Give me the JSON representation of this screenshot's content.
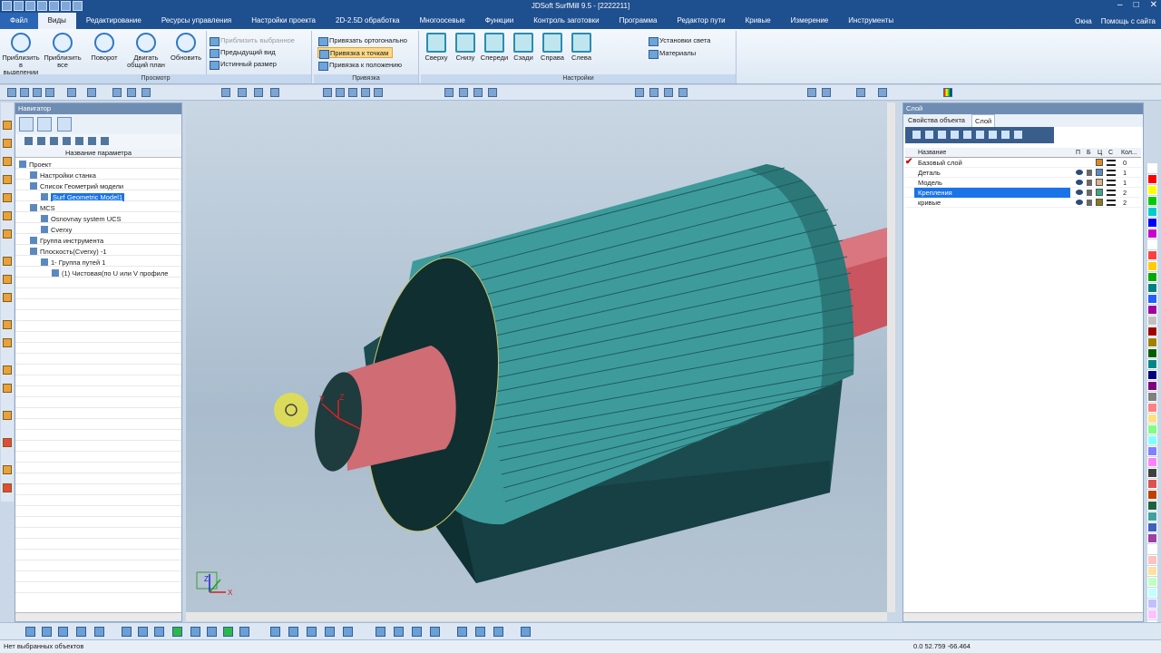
{
  "window": {
    "title": "JDSoft SurfMill 9.5 - [2222211]"
  },
  "menu": {
    "tabs": [
      "Файл",
      "Виды",
      "Редактирование",
      "Ресурсы управления",
      "Настройки проекта",
      "2D-2.5D обработка",
      "Многоосевые",
      "Функции",
      "Контроль заготовки",
      "Программа",
      "Редактор пути",
      "Кривые",
      "Измерение",
      "Инструменты"
    ],
    "active_index": 1,
    "right": {
      "windows": "Окна",
      "help": "Помощь с сайта"
    }
  },
  "ribbon": {
    "view_group": {
      "label": "Просмотр",
      "buttons": [
        "Приблизить в выделении",
        "Приблизить все",
        "Поворот",
        "Двигать общий план",
        "Обновить"
      ],
      "small": [
        "Приблизить выбранное",
        "Предыдущий вид",
        "Истинный размер"
      ]
    },
    "snap_group": {
      "label": "Привязка",
      "items": [
        "Привязать ортогонально",
        "Привязка к точкам",
        "Привязка к положению"
      ]
    },
    "settings_group": {
      "label": "Настройки",
      "views": [
        "Сверху",
        "Снизу",
        "Спереди",
        "Сзади",
        "Справа",
        "Слева"
      ],
      "small": [
        "Установки света",
        "Материалы"
      ]
    }
  },
  "navigator": {
    "title": "Навигатор",
    "column": "Название параметра",
    "tree": [
      {
        "label": "Проект",
        "level": 0
      },
      {
        "label": "Настройки станка",
        "level": 1
      },
      {
        "label": "Список Геометрий модели",
        "level": 1
      },
      {
        "label": "Surf Geometric Model1",
        "level": 2,
        "selected": true
      },
      {
        "label": "MCS",
        "level": 1
      },
      {
        "label": "Osnovnay system UCS",
        "level": 2
      },
      {
        "label": "Cverxy",
        "level": 2
      },
      {
        "label": "Группа инструмента",
        "level": 1
      },
      {
        "label": "Плоскость(Cverxy) -1",
        "level": 1
      },
      {
        "label": "1- Группа путей 1",
        "level": 2
      },
      {
        "label": "(1) Чистовая(по U или V профиле",
        "level": 3
      }
    ]
  },
  "layers": {
    "title": "Слой",
    "tabs": [
      "Свойства объекта",
      "Слой"
    ],
    "columns": {
      "name": "Название",
      "p": "П",
      "b": "Б",
      "c": "Ц",
      "s": "С",
      "count": "Кол..."
    },
    "rows": [
      {
        "name": "Базовый слой",
        "color": "#e08a1e",
        "count": "0",
        "current": true
      },
      {
        "name": "Деталь",
        "color": "#5a8cc4",
        "count": "1"
      },
      {
        "name": "Модель",
        "color": "#d9b48a",
        "count": "1"
      },
      {
        "name": "Крепления",
        "color": "#3aa88a",
        "count": "2",
        "selected": true
      },
      {
        "name": "кривые",
        "color": "#8a7a1a",
        "count": "2"
      }
    ]
  },
  "status": {
    "left": "Нет выбранных объектов",
    "coords": "0.0 52.759 -66.464"
  },
  "viewport": {
    "triad_labels": {
      "x": "X",
      "y": "Y",
      "z": "Z"
    }
  },
  "palette": [
    "#ffffff",
    "#ff0000",
    "#ffff00",
    "#00cc00",
    "#00cccc",
    "#0000ff",
    "#cc00cc",
    "#ffffff",
    "#ff4040",
    "#ffcc00",
    "#00aa00",
    "#008080",
    "#2060ff",
    "#a000a0",
    "#c0c0c0",
    "#a00000",
    "#a08000",
    "#006000",
    "#008888",
    "#000080",
    "#800080",
    "#808080",
    "#ff8080",
    "#ffe080",
    "#80ff80",
    "#80ffff",
    "#8080ff",
    "#ff80ff",
    "#404040",
    "#e05050",
    "#c04000",
    "#206040",
    "#40a0a0",
    "#4060c0",
    "#a040a0",
    "#ffffff",
    "#ffc0c0",
    "#ffe0a0",
    "#c0ffc0",
    "#c0ffff",
    "#c0c0ff",
    "#ffc0ff",
    "#ffffff",
    "#cc0000",
    "#e0e0e0"
  ]
}
